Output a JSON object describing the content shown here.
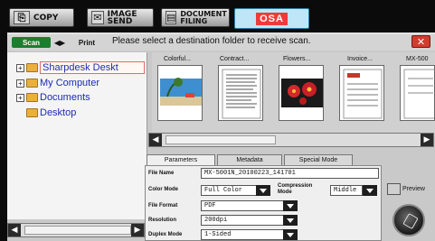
{
  "topbar": {
    "buttons": [
      {
        "label": "COPY",
        "icon": "copy-icon"
      },
      {
        "label": "IMAGE SEND",
        "icon": "image-send-icon"
      },
      {
        "label": "DOCUMENT FILING",
        "icon": "document-filing-icon"
      }
    ],
    "osa_label": "OSA"
  },
  "mode": {
    "scan": "Scan",
    "arrows": "◀▶",
    "print": "Print"
  },
  "instruction": "Please select a destination folder to receive scan.",
  "close_label": "✕",
  "tree": {
    "nodes": [
      {
        "label": "Sharpdesk Deskt",
        "expandable": true
      },
      {
        "label": "My Computer",
        "expandable": true
      },
      {
        "label": "Documents",
        "expandable": true
      },
      {
        "label": "Desktop",
        "expandable": false
      }
    ]
  },
  "thumbnails": [
    {
      "label": "Colorful..."
    },
    {
      "label": "Contract..."
    },
    {
      "label": "Flowers..."
    },
    {
      "label": "Invoice..."
    },
    {
      "label": "MX-500"
    }
  ],
  "tabs": [
    "Parameters",
    "Metadata",
    "Special Mode"
  ],
  "params": {
    "file_name_label": "File Name",
    "file_name_value": "MX-5001N_20100223_141701",
    "color_mode_label": "Color Mode",
    "color_mode_value": "Full Color",
    "compression_label_1": "Compression",
    "compression_label_2": "Mode",
    "compression_value": "Middle",
    "file_format_label": "File Format",
    "file_format_value": "PDF",
    "resolution_label": "Resolution",
    "resolution_value": "200dpi",
    "duplex_label": "Duplex Mode",
    "duplex_value": "1-Sided"
  },
  "preview_label": "Preview",
  "colors": {
    "scan_mode": "#1b7e2e",
    "close": "#d43b2f",
    "osa_bg": "#bfe6f7",
    "osa_text_bg": "#ef3a3a",
    "folder": "#e8b13c",
    "tree_text": "#1c2bb5"
  }
}
